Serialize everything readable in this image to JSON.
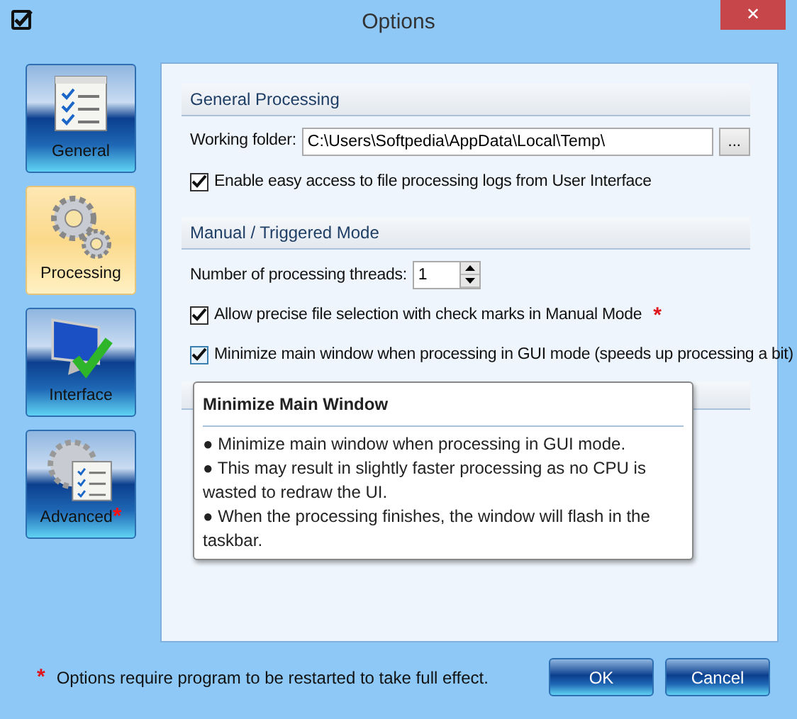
{
  "window": {
    "title": "Options",
    "close": "✕"
  },
  "sidebar": {
    "items": [
      {
        "label": "General",
        "selected": false
      },
      {
        "label": "Processing",
        "selected": true
      },
      {
        "label": "Interface",
        "selected": false
      },
      {
        "label": "Advanced",
        "selected": false,
        "starred": true
      }
    ]
  },
  "sections": [
    {
      "title": "General Processing",
      "rows": [
        {
          "kind": "folder",
          "label": "Working folder:",
          "value": "C:\\Users\\Softpedia\\AppData\\Local\\Temp\\",
          "button": "..."
        },
        {
          "kind": "checkbox",
          "label": "Enable easy access to file processing logs from User Interface",
          "checked": true
        }
      ]
    },
    {
      "title": "Manual / Triggered Mode",
      "rows": [
        {
          "kind": "spinner",
          "label": "Number of processing threads:",
          "value": "1"
        },
        {
          "kind": "checkbox",
          "label": "Allow precise file selection with check marks in Manual Mode",
          "checked": true,
          "starred": true
        },
        {
          "kind": "checkbox",
          "label": "Minimize main window when processing in GUI mode (speeds up processing a bit)",
          "checked": true,
          "hovered": true
        }
      ]
    }
  ],
  "tooltip": {
    "title": "Minimize Main Window",
    "lines": [
      "● Minimize main window when processing in GUI mode.",
      "● This may result in slightly faster processing as no CPU is wasted to redraw the UI.",
      "● When the processing finishes, the window will flash in the taskbar."
    ]
  },
  "footer": {
    "star": "*",
    "note": "Options require program to be restarted to take full effect.",
    "buttons": [
      "OK",
      "Cancel"
    ]
  }
}
